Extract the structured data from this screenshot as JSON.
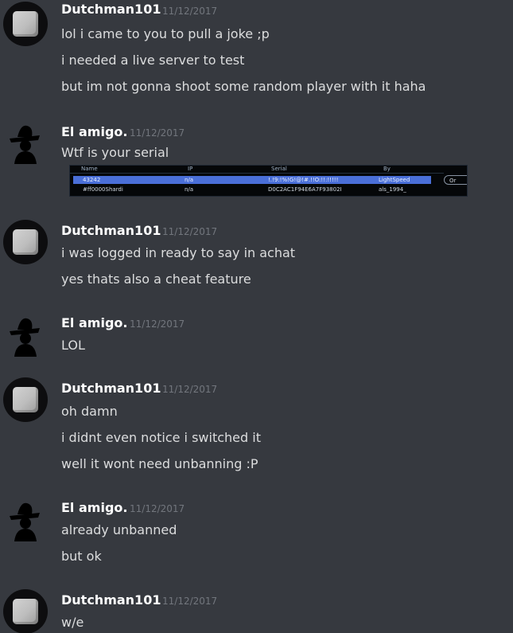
{
  "users": {
    "dutchman": "Dutchman101",
    "elamigo": "El amigo."
  },
  "groups": [
    {
      "author": "Dutchman101",
      "timestamp": "11/12/2017",
      "lines": [
        "lol i came to you to pull a joke ;p",
        "i needed a live server to test",
        "but im not gonna shoot some random player with it haha"
      ]
    },
    {
      "author": "El amigo.",
      "timestamp": "11/12/2017",
      "lines": [
        "Wtf is your serial"
      ]
    },
    {
      "author": "Dutchman101",
      "timestamp": "11/12/2017",
      "lines": [
        "i was logged in ready to say in achat",
        "yes thats also a cheat feature"
      ]
    },
    {
      "author": "El amigo.",
      "timestamp": "11/12/2017",
      "lines": [
        "LOL"
      ]
    },
    {
      "author": "Dutchman101",
      "timestamp": "11/12/2017",
      "lines": [
        "oh damn",
        "i didnt even notice i switched it",
        "well it wont need unbanning :P"
      ]
    },
    {
      "author": "El amigo.",
      "timestamp": "11/12/2017",
      "lines": [
        "already unbanned",
        "but ok"
      ]
    },
    {
      "author": "Dutchman101",
      "timestamp": "11/12/2017",
      "lines": [
        "w/e"
      ]
    }
  ],
  "serial_table": {
    "headers": [
      "Name",
      "IP",
      "Serial",
      "By"
    ],
    "rows": [
      [
        "43242",
        "n/a",
        "!.!9:!%!G!@!#.!!O:!!:!!!!!",
        "LightSpeed"
      ],
      [
        "#ff0000Shardi",
        "n/a",
        "D0C2AC1F94E6A7F93802I",
        "als_1994_"
      ]
    ],
    "side_button": "Or"
  },
  "avatar_icons": {
    "dutchman": "gray-cube-avatar-icon",
    "elamigo": "silhouette-hat-avatar-icon"
  }
}
